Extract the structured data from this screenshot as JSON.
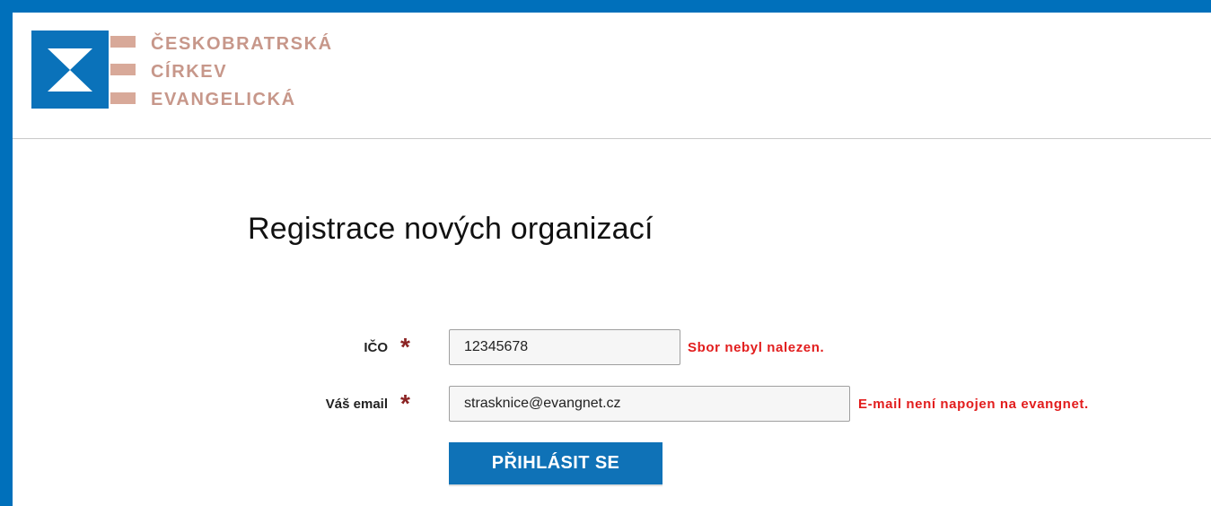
{
  "logo": {
    "lines": [
      "ČESKOBRATRSKÁ",
      "CÍRKEV",
      "EVANGELICKÁ"
    ],
    "icon": "hourglass-icon"
  },
  "page": {
    "title": "Registrace nových organizací"
  },
  "form": {
    "ico": {
      "label": "IČO",
      "required_mark": "*",
      "value": "12345678",
      "error": "Sbor nebyl nalezen."
    },
    "email": {
      "label": "Váš email",
      "required_mark": "*",
      "value": "strasknice@evangnet.cz",
      "error": "E-mail není napojen na evangnet."
    },
    "submit_label": "PŘIHLÁSIT SE"
  },
  "colors": {
    "accent": "#0070bb",
    "logo_text": "#c7978a",
    "error": "#e21d1d",
    "required": "#8b2323"
  }
}
